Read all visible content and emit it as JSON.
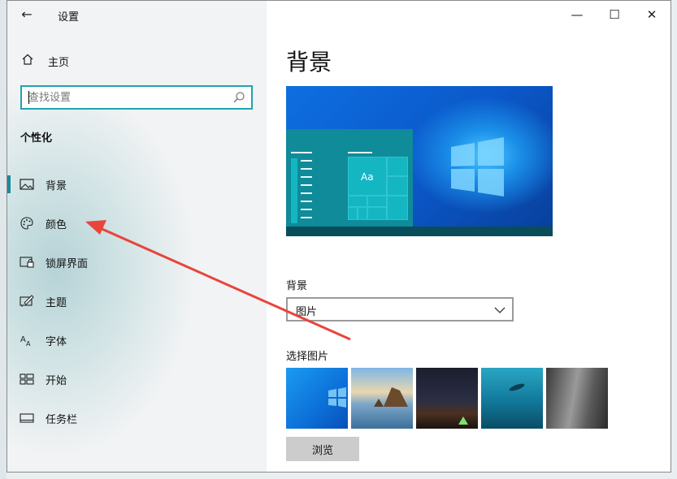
{
  "window": {
    "title": "设置",
    "back_icon": "back-arrow-icon"
  },
  "controls": {
    "minimize": "—",
    "maximize": "☐",
    "close": "✕"
  },
  "sidebar": {
    "home_label": "主页",
    "search_placeholder": "查找设置",
    "section_title": "个性化",
    "items": [
      {
        "label": "背景",
        "icon": "picture-icon",
        "active": true
      },
      {
        "label": "颜色",
        "icon": "palette-icon"
      },
      {
        "label": "锁屏界面",
        "icon": "lock-screen-icon"
      },
      {
        "label": "主题",
        "icon": "theme-icon"
      },
      {
        "label": "字体",
        "icon": "font-icon"
      },
      {
        "label": "开始",
        "icon": "start-icon"
      },
      {
        "label": "任务栏",
        "icon": "taskbar-icon"
      }
    ]
  },
  "main": {
    "heading": "背景",
    "preview_tile_text": "Aa",
    "background_label": "背景",
    "background_value": "图片",
    "choose_picture_label": "选择图片",
    "thumbnails": [
      "windows-blue-wallpaper",
      "beach-rock-wallpaper",
      "night-sky-tent-wallpaper",
      "underwater-swimmer-wallpaper",
      "rock-cliff-wallpaper"
    ],
    "browse_label": "浏览"
  },
  "colors": {
    "accent": "#1fa3b0",
    "arrow": "#e8453c",
    "preview_panel": "#0f8b99"
  }
}
